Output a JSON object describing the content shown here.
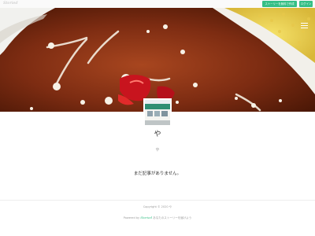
{
  "header": {
    "brand": "Storied",
    "create_button": "ストーリーを無料で作成",
    "login_button": "ログイン"
  },
  "hero": {
    "menu_icon": "hamburger-menu-icon"
  },
  "blog": {
    "title": "や",
    "description": "や",
    "empty_message": "まだ記事がありません。"
  },
  "footer": {
    "copyright": "Copyright © 2020 や",
    "powered_prefix": "Powered by",
    "powered_logo": "Storied",
    "powered_suffix": "あなたのストーリーを届けよう"
  },
  "colors": {
    "accent": "#35bf85",
    "text": "#333333",
    "muted": "#999999"
  }
}
